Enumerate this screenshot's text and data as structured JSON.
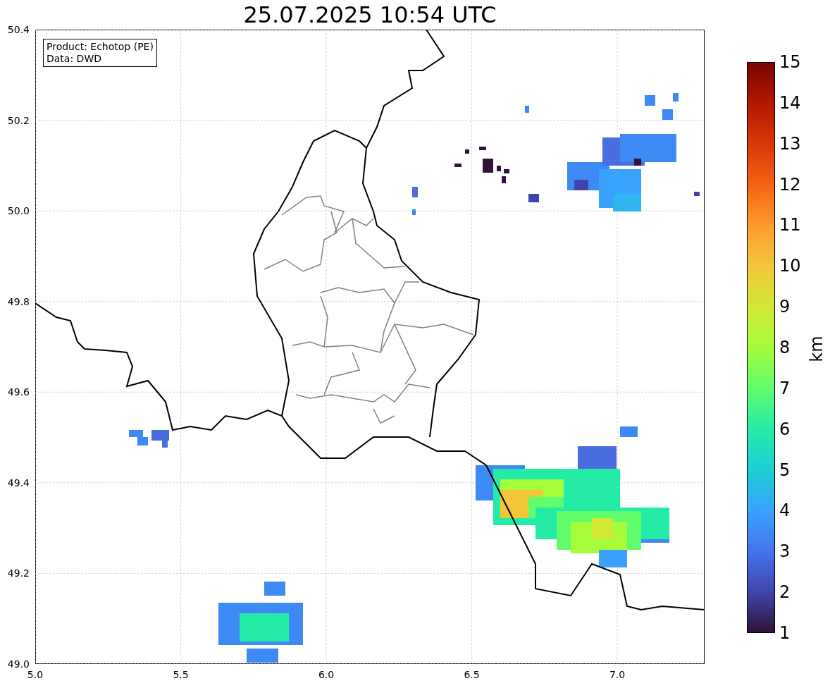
{
  "title": "25.07.2025 10:54 UTC",
  "info_box": {
    "lines": [
      "Product: Echotop (PE)",
      "Data: DWD"
    ]
  },
  "y_ticks": [
    "50.4",
    "50.2",
    "50.0",
    "49.8",
    "49.6",
    "49.4",
    "49.2",
    "49.0"
  ],
  "x_ticks": [
    "5.0",
    "5.5",
    "6.0",
    "6.5",
    "7.0"
  ],
  "colorbar": {
    "label": "km",
    "ticks": [
      "15",
      "14",
      "13",
      "12",
      "11",
      "10",
      "9",
      "8",
      "7",
      "6",
      "5",
      "4",
      "3",
      "2",
      "1"
    ]
  }
}
